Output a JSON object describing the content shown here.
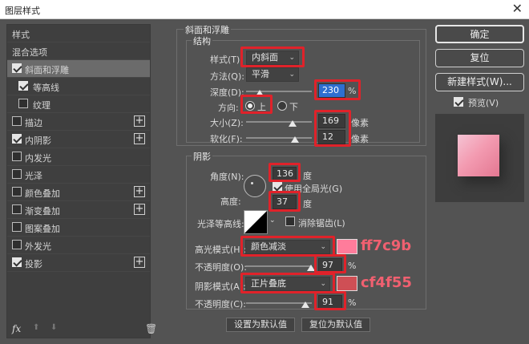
{
  "window": {
    "title": "图层样式",
    "close_glyph": "✕"
  },
  "left": {
    "items": [
      {
        "label": "样式",
        "check": null,
        "plus": false,
        "selected": false
      },
      {
        "label": "混合选项",
        "check": null,
        "plus": false,
        "selected": false
      },
      {
        "label": "斜面和浮雕",
        "check": true,
        "plus": false,
        "selected": true
      },
      {
        "label": "等高线",
        "check": true,
        "plus": false,
        "selected": false,
        "indent": true
      },
      {
        "label": "纹理",
        "check": false,
        "plus": false,
        "selected": false,
        "indent": true
      },
      {
        "label": "描边",
        "check": false,
        "plus": true,
        "selected": false
      },
      {
        "label": "内阴影",
        "check": true,
        "plus": true,
        "selected": false
      },
      {
        "label": "内发光",
        "check": false,
        "plus": false,
        "selected": false
      },
      {
        "label": "光泽",
        "check": false,
        "plus": false,
        "selected": false
      },
      {
        "label": "颜色叠加",
        "check": false,
        "plus": true,
        "selected": false
      },
      {
        "label": "渐变叠加",
        "check": false,
        "plus": true,
        "selected": false
      },
      {
        "label": "图案叠加",
        "check": false,
        "plus": false,
        "selected": false
      },
      {
        "label": "外发光",
        "check": false,
        "plus": false,
        "selected": false
      },
      {
        "label": "投影",
        "check": true,
        "plus": true,
        "selected": false
      }
    ],
    "fx": "fx",
    "plus_glyph": "+",
    "up_glyph": "⬆",
    "down_glyph": "⬇",
    "trash_glyph": "🗑"
  },
  "bevel": {
    "section_title": "斜面和浮雕",
    "structure_title": "结构",
    "style_label": "样式(T):",
    "style_value": "内斜面",
    "technique_label": "方法(Q):",
    "technique_value": "平滑",
    "depth_label": "深度(D):",
    "depth_value": "230",
    "depth_unit": "%",
    "direction_label": "方向:",
    "dir_up": "上",
    "dir_down": "下",
    "size_label": "大小(Z):",
    "size_value": "169",
    "size_unit": "像素",
    "soften_label": "软化(F):",
    "soften_value": "12",
    "soften_unit": "像素"
  },
  "shading": {
    "title": "阴影",
    "angle_label": "角度(N):",
    "angle_value": "136",
    "angle_unit": "度",
    "global_light_label": "使用全局光(G)",
    "altitude_label": "高度:",
    "altitude_value": "37",
    "altitude_unit": "度",
    "gloss_label": "光泽等高线:",
    "antialias_label": "消除锯齿(L)",
    "highlight_label": "高光模式(H):",
    "highlight_mode": "颜色减淡",
    "highlight_color": "#ff7c9b",
    "highlight_note": "ff7c9b",
    "hl_opacity_label": "不透明度(O):",
    "hl_opacity_value": "97",
    "hl_opacity_unit": "%",
    "shadow_label": "阴影模式(A):",
    "shadow_mode": "正片叠底",
    "shadow_color": "#cf4f55",
    "shadow_note": "cf4f55",
    "sh_opacity_label": "不透明度(C):",
    "sh_opacity_value": "91",
    "sh_opacity_unit": "%",
    "make_default": "设置为默认值",
    "reset_default": "复位为默认值"
  },
  "right": {
    "ok": "确定",
    "reset": "复位",
    "new_style": "新建样式(W)...",
    "preview_label": "预览(V)"
  },
  "chevron": "⌄"
}
